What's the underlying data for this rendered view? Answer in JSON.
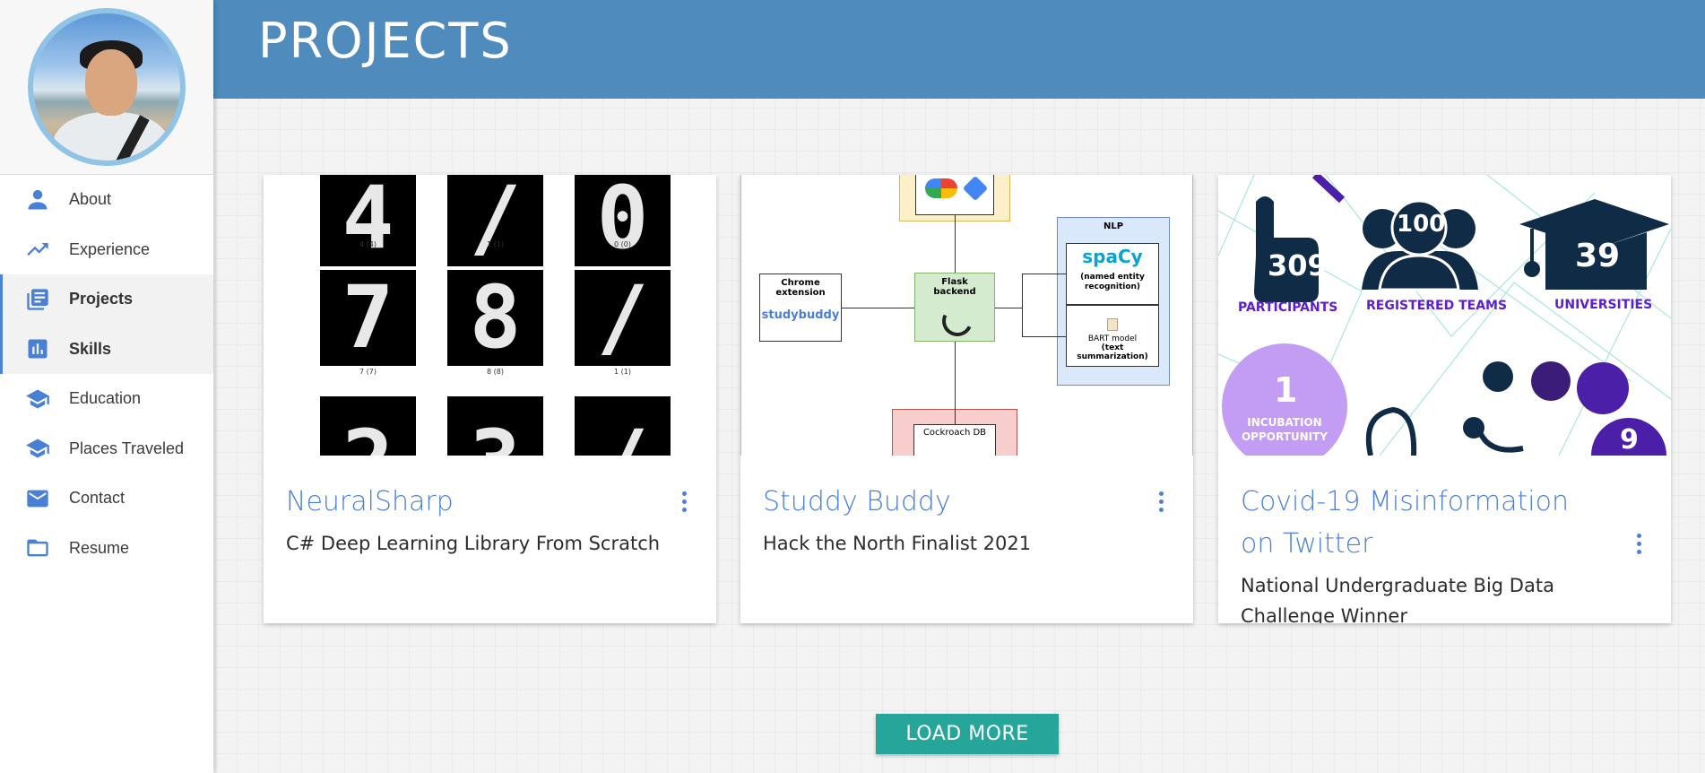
{
  "header": {
    "title": "PROJECTS"
  },
  "sidebar": {
    "items": [
      {
        "label": "About",
        "icon": "person-icon"
      },
      {
        "label": "Experience",
        "icon": "trending-up-icon"
      },
      {
        "label": "Projects",
        "icon": "library-books-icon"
      },
      {
        "label": "Skills",
        "icon": "bar-chart-icon"
      },
      {
        "label": "Education",
        "icon": "school-icon"
      },
      {
        "label": "Places Traveled",
        "icon": "school-icon"
      },
      {
        "label": "Contact",
        "icon": "mail-icon"
      },
      {
        "label": "Resume",
        "icon": "folder-icon"
      }
    ]
  },
  "cards": [
    {
      "title": "NeuralSharp",
      "subtitle": "C# Deep Learning Library From Scratch",
      "image": {
        "labels": [
          "4 (4)",
          "1 (1)",
          "0 (0)",
          "7 (7)",
          "8 (8)",
          "1 (1)"
        ]
      }
    },
    {
      "title": "Studdy Buddy",
      "subtitle": "Hack the North Finalist 2021",
      "image": {
        "chrome_extension": "Chrome extension",
        "studybuddy": "studybuddy",
        "flask": "Flask backend",
        "nlp": "NLP",
        "spacy": "spaCy",
        "spacy_desc": "(named entity recognition)",
        "bart": "BART model",
        "bart_desc": "(text summarization)",
        "cockroach": "Cockroach DB"
      }
    },
    {
      "title": "Covid-19 Misinformation on Twitter",
      "subtitle": "National Undergraduate Big Data Challenge Winner",
      "image": {
        "participants_num": "309",
        "participants_label": "PARTICIPANTS",
        "teams_num": "100",
        "teams_label": "REGISTERED TEAMS",
        "universities_num": "39",
        "universities_label": "UNIVERSITIES",
        "incubation_num": "1",
        "incubation_label": "INCUBATION OPPORTUNITY",
        "partial_num": "9"
      }
    }
  ],
  "load_more_label": "LOAD MORE",
  "colors": {
    "header": "#4f8bbd",
    "accent": "#4a80d8",
    "button": "#26a69a"
  }
}
